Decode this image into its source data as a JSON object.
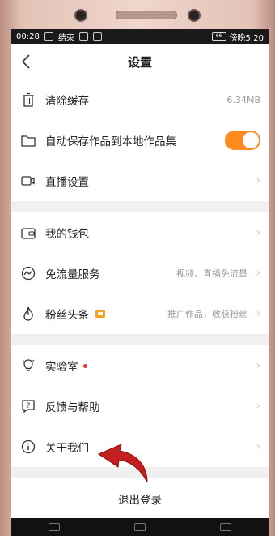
{
  "status": {
    "time": "00:28",
    "call_end": "结束",
    "right_text": "傍晚5:20",
    "battery": "66"
  },
  "header": {
    "title": "设置"
  },
  "group1": {
    "clear_cache": {
      "label": "清除缓存",
      "value": "6.34MB"
    },
    "auto_save": {
      "label": "自动保存作品到本地作品集",
      "enabled": true
    },
    "live": {
      "label": "直播设置"
    }
  },
  "group2": {
    "wallet": {
      "label": "我的钱包"
    },
    "free_data": {
      "label": "免流量服务",
      "value": "视频、直播免流量"
    },
    "fans": {
      "label": "粉丝头条",
      "value": "推广作品，收获粉丝"
    }
  },
  "group3": {
    "lab": {
      "label": "实验室"
    },
    "feedback": {
      "label": "反馈与帮助"
    },
    "about": {
      "label": "关于我们"
    }
  },
  "logout": {
    "label": "退出登录"
  },
  "colors": {
    "accent": "#ff8a1e",
    "red_dot": "#e8363a",
    "arrow": "#c41f1f"
  },
  "icons": {
    "back": "chevron-left-icon",
    "trash": "trash-icon",
    "folder": "folder-icon",
    "video": "video-camera-icon",
    "wallet": "wallet-icon",
    "traffic": "traffic-icon",
    "flame": "flame-icon",
    "bulb": "lightbulb-icon",
    "help": "question-icon",
    "info": "info-icon"
  }
}
